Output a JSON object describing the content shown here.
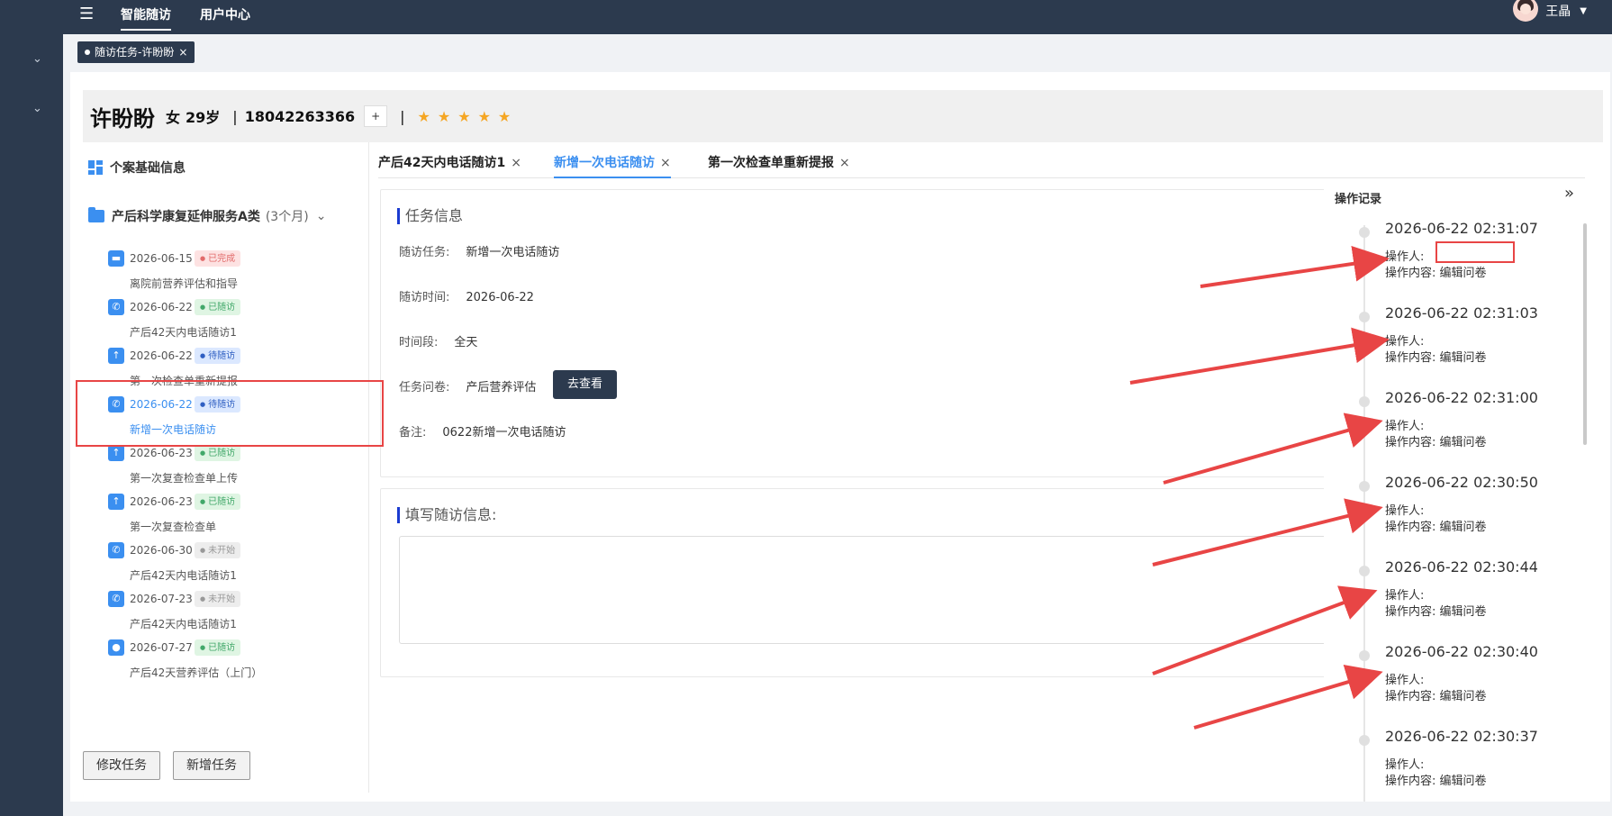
{
  "topbar": {
    "nav": [
      "智能随访",
      "用户中心"
    ],
    "user_name": "王晶",
    "menu_icon": "menu-fold-icon"
  },
  "page_tab": {
    "label": "随访任务-许盼盼",
    "close": "×"
  },
  "patient": {
    "name": "许盼盼",
    "gender": "女",
    "age": "29岁",
    "sep": "|",
    "phone": "18042263366",
    "plus": "+",
    "stars": "★★★★★"
  },
  "left": {
    "basic_info": "个案基础信息",
    "service_name": "产后科学康复延伸服务A类",
    "service_duration": "(3个月)",
    "timeline": [
      {
        "date": "2026-06-15",
        "badge": "已完成",
        "title": "离院前营养评估和指导",
        "icon": "book-icon"
      },
      {
        "date": "2026-06-22",
        "badge": "已随访",
        "title": "产后42天内电话随访1",
        "icon": "phone-icon"
      },
      {
        "date": "2026-06-22",
        "badge": "待随访",
        "title": "第一次检查单重新提报",
        "icon": "upload-icon"
      },
      {
        "date": "2026-06-22",
        "badge": "待随访",
        "title": "新增一次电话随访",
        "icon": "phone-icon"
      },
      {
        "date": "2026-06-23",
        "badge": "已随访",
        "title": "第一次复查检查单上传",
        "icon": "upload-icon"
      },
      {
        "date": "2026-06-23",
        "badge": "已随访",
        "title": "第一次复查检查单",
        "icon": "upload-icon"
      },
      {
        "date": "2026-06-30",
        "badge": "未开始",
        "title": "产后42天内电话随访1",
        "icon": "phone-icon"
      },
      {
        "date": "2026-07-23",
        "badge": "未开始",
        "title": "产后42天内电话随访1",
        "icon": "phone-icon"
      },
      {
        "date": "2026-07-27",
        "badge": "已随访",
        "title": "产后42天营养评估（上门）",
        "icon": "person-icon"
      }
    ],
    "edit_button": "修改任务",
    "add_button": "新增任务"
  },
  "record_tabs": [
    "产后42天内电话随访1",
    "新增一次电话随访",
    "第一次检查单重新提报"
  ],
  "task_info": {
    "title": "任务信息",
    "task_label": "随访任务:",
    "task_value": "新增一次电话随访",
    "time_label": "随访时间:",
    "time_value": "2026-06-22",
    "period_label": "时间段:",
    "period_value": "全天",
    "questionnaire_label": "任务问卷:",
    "questionnaire_value": "产后营养评估",
    "view_button": "去查看",
    "remark_label": "备注:",
    "remark_value": "0622新增一次电话随访"
  },
  "fill_info": {
    "title": "填写随访信息:"
  },
  "log": {
    "title": "操作记录",
    "operator_label": "操作人:",
    "content_label": "操作内容:",
    "items": [
      {
        "time": "2026-06-22 02:31:07",
        "content": "编辑问卷"
      },
      {
        "time": "2026-06-22 02:31:03",
        "content": "编辑问卷"
      },
      {
        "time": "2026-06-22 02:31:00",
        "content": "编辑问卷"
      },
      {
        "time": "2026-06-22 02:30:50",
        "content": "编辑问卷"
      },
      {
        "time": "2026-06-22 02:30:44",
        "content": "编辑问卷"
      },
      {
        "time": "2026-06-22 02:30:40",
        "content": "编辑问卷"
      },
      {
        "time": "2026-06-22 02:30:37",
        "content": "编辑问卷"
      }
    ]
  },
  "colors": {
    "nav_bg": "#2c3a4e",
    "accent": "#3b8ff0",
    "annotation": "#e84545",
    "star": "#f5a623"
  }
}
